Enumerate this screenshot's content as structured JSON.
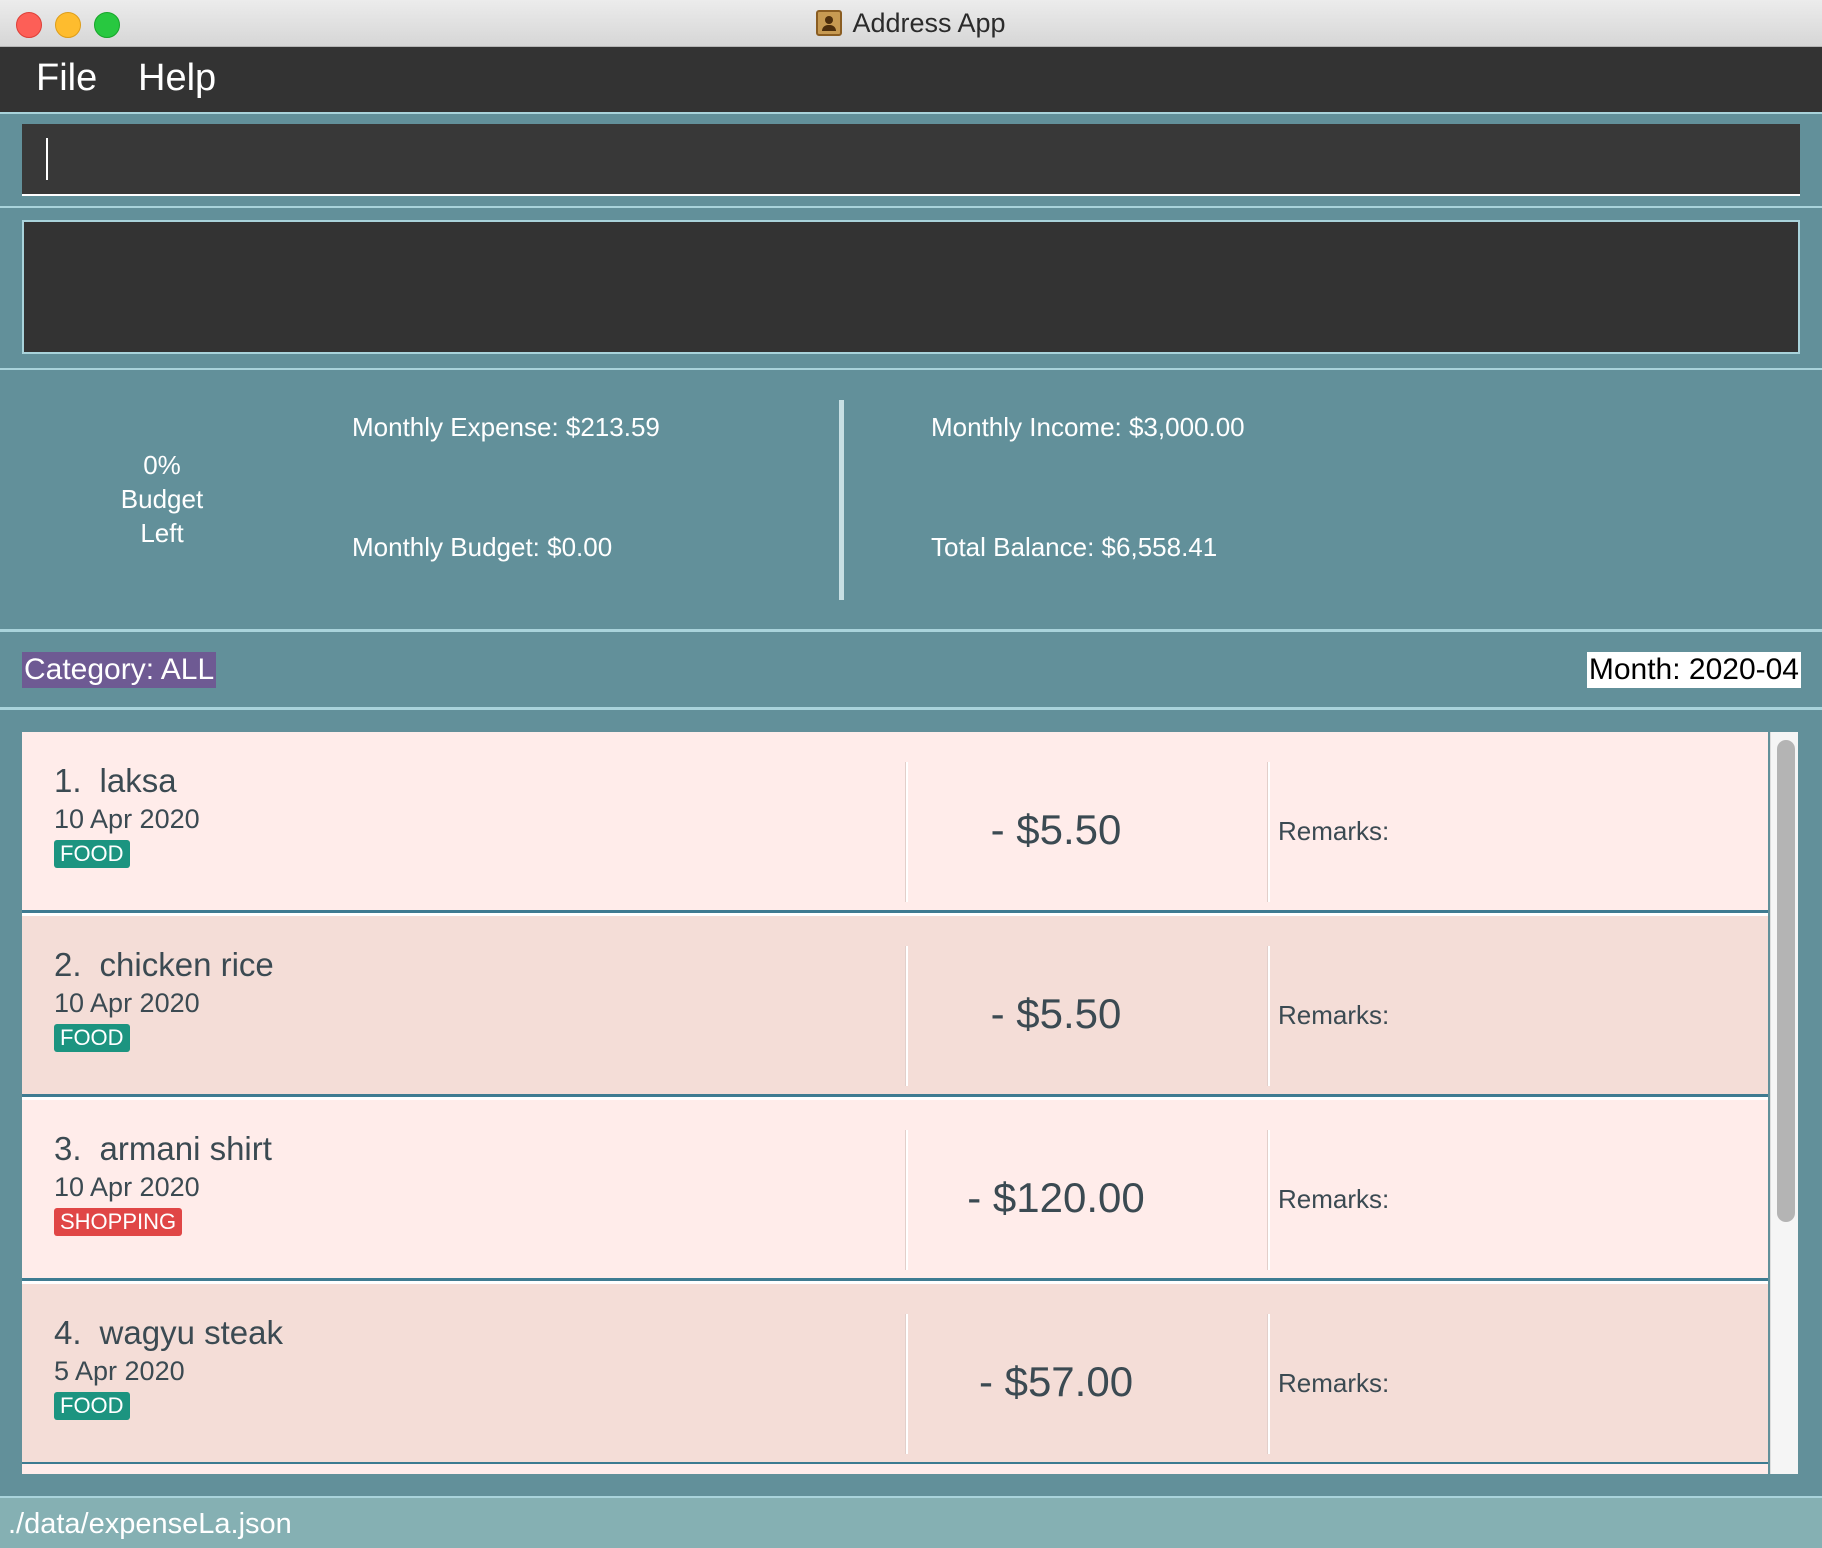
{
  "window": {
    "title": "Address App"
  },
  "menu": {
    "file_label": "File",
    "help_label": "Help"
  },
  "command": {
    "value": "",
    "placeholder": ""
  },
  "result": {
    "text": ""
  },
  "summary": {
    "budget_percent": "0%",
    "budget_line2": "Budget",
    "budget_line3": "Left",
    "monthly_expense": "Monthly Expense: $213.59",
    "monthly_budget": "Monthly Budget: $0.00",
    "monthly_income": "Monthly Income: $3,000.00",
    "total_balance": "Total Balance: $6,558.41"
  },
  "filter": {
    "category": "Category: ALL",
    "month": "Month: 2020-04"
  },
  "expenses": [
    {
      "index": "1.",
      "name": "laksa",
      "date": "10 Apr 2020",
      "tag": "FOOD",
      "amount": "- $5.50",
      "remarks": "Remarks:"
    },
    {
      "index": "2.",
      "name": "chicken rice",
      "date": "10 Apr 2020",
      "tag": "FOOD",
      "amount": "- $5.50",
      "remarks": "Remarks:"
    },
    {
      "index": "3.",
      "name": "armani shirt",
      "date": "10 Apr 2020",
      "tag": "SHOPPING",
      "amount": "- $120.00",
      "remarks": "Remarks:"
    },
    {
      "index": "4.",
      "name": "wagyu steak",
      "date": "5 Apr 2020",
      "tag": "FOOD",
      "amount": "- $57.00",
      "remarks": "Remarks:"
    }
  ],
  "status": {
    "file_path": "./data/expenseLa.json"
  },
  "colors": {
    "panel_bg": "#62909a",
    "food_tag": "#1c9480",
    "shopping_tag": "#e04646",
    "category_bg": "#6e5a93"
  }
}
